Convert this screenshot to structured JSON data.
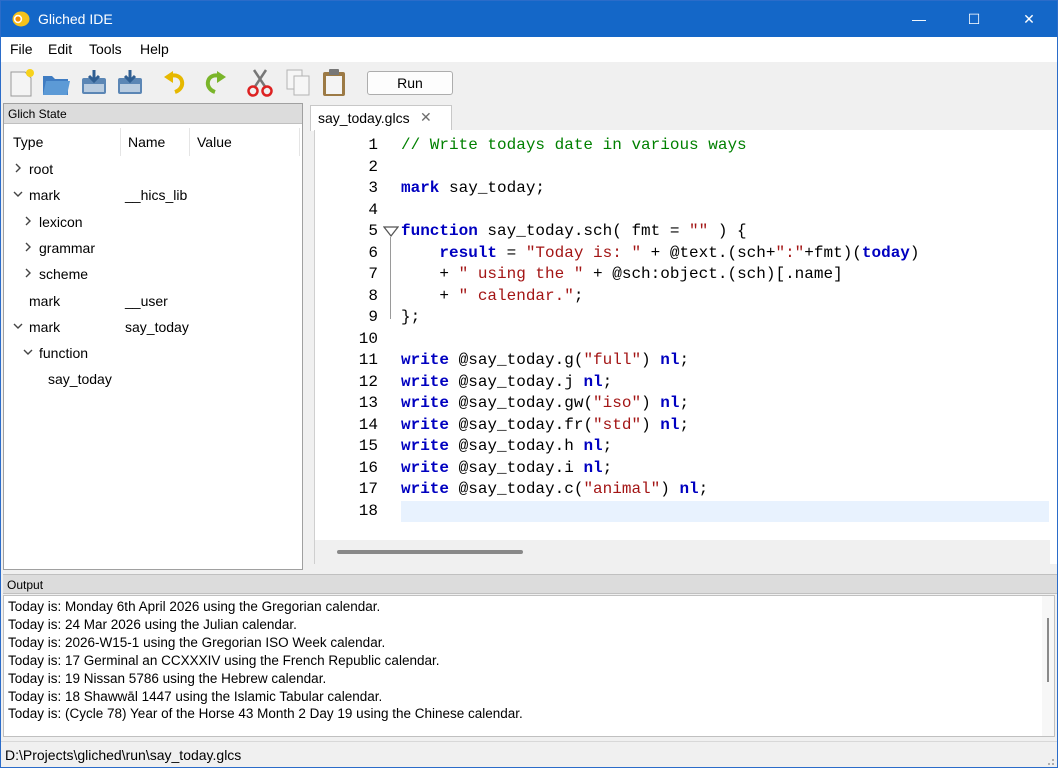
{
  "window": {
    "title": "Gliched IDE",
    "minimize_glyph": "—",
    "maximize_glyph": "☐",
    "close_glyph": "✕",
    "titlebar_color": "#1467c8"
  },
  "menu": [
    "File",
    "Edit",
    "Tools",
    "Help"
  ],
  "toolbar": {
    "icons": [
      "new-file-icon",
      "open-folder-icon",
      "save-icon",
      "save-as-icon",
      "undo-icon",
      "redo-icon",
      "cut-icon",
      "copy-icon",
      "paste-icon"
    ],
    "run_label": "Run"
  },
  "state_panel": {
    "title": "Glich State",
    "columns": [
      "Type",
      "Name",
      "Value"
    ],
    "rows": [
      {
        "chevron": "right",
        "type": "root",
        "name": ""
      },
      {
        "chevron": "down",
        "type": "mark",
        "name": "__hics_lib"
      },
      {
        "chevron": "right",
        "type": "lexicon",
        "name": ""
      },
      {
        "chevron": "right",
        "type": "grammar",
        "name": ""
      },
      {
        "chevron": "right",
        "type": "scheme",
        "name": ""
      },
      {
        "chevron": "none",
        "type": "mark",
        "name": "__user"
      },
      {
        "chevron": "down",
        "type": "mark",
        "name": "say_today"
      },
      {
        "chevron": "down",
        "type": "function",
        "name": ""
      },
      {
        "chevron": "none",
        "type": "say_today",
        "name": ""
      }
    ]
  },
  "editor": {
    "tab_label": "say_today.glcs",
    "tab_close": "✕",
    "lines": [
      [
        [
          "cm",
          "// Write todays date in various ways"
        ]
      ],
      [],
      [
        [
          "kw",
          "mark"
        ],
        [
          "pl",
          " say_today;"
        ]
      ],
      [],
      [
        [
          "kw",
          "function"
        ],
        [
          "pl",
          " say_today.sch( fmt = "
        ],
        [
          "st",
          "\"\""
        ],
        [
          "pl",
          " ) {"
        ]
      ],
      [
        [
          "pl",
          "    "
        ],
        [
          "kw",
          "result"
        ],
        [
          "pl",
          " = "
        ],
        [
          "st",
          "\"Today is: \""
        ],
        [
          "pl",
          " + @text.(sch+"
        ],
        [
          "st",
          "\":\""
        ],
        [
          "pl",
          "+fmt)("
        ],
        [
          "kw",
          "today"
        ],
        [
          "pl",
          ")"
        ]
      ],
      [
        [
          "pl",
          "    + "
        ],
        [
          "st",
          "\" using the \""
        ],
        [
          "pl",
          " + @sch:object.(sch)[.name]"
        ]
      ],
      [
        [
          "pl",
          "    + "
        ],
        [
          "st",
          "\" calendar.\""
        ],
        [
          "pl",
          ";"
        ]
      ],
      [
        [
          "pl",
          "};"
        ]
      ],
      [],
      [
        [
          "kw",
          "write"
        ],
        [
          "pl",
          " @say_today.g("
        ],
        [
          "st",
          "\"full\""
        ],
        [
          "pl",
          ") "
        ],
        [
          "kw",
          "nl"
        ],
        [
          "pl",
          ";"
        ]
      ],
      [
        [
          "kw",
          "write"
        ],
        [
          "pl",
          " @say_today.j "
        ],
        [
          "kw",
          "nl"
        ],
        [
          "pl",
          ";"
        ]
      ],
      [
        [
          "kw",
          "write"
        ],
        [
          "pl",
          " @say_today.gw("
        ],
        [
          "st",
          "\"iso\""
        ],
        [
          "pl",
          ") "
        ],
        [
          "kw",
          "nl"
        ],
        [
          "pl",
          ";"
        ]
      ],
      [
        [
          "kw",
          "write"
        ],
        [
          "pl",
          " @say_today.fr("
        ],
        [
          "st",
          "\"std\""
        ],
        [
          "pl",
          ") "
        ],
        [
          "kw",
          "nl"
        ],
        [
          "pl",
          ";"
        ]
      ],
      [
        [
          "kw",
          "write"
        ],
        [
          "pl",
          " @say_today.h "
        ],
        [
          "kw",
          "nl"
        ],
        [
          "pl",
          ";"
        ]
      ],
      [
        [
          "kw",
          "write"
        ],
        [
          "pl",
          " @say_today.i "
        ],
        [
          "kw",
          "nl"
        ],
        [
          "pl",
          ";"
        ]
      ],
      [
        [
          "kw",
          "write"
        ],
        [
          "pl",
          " @say_today.c("
        ],
        [
          "st",
          "\"animal\""
        ],
        [
          "pl",
          ") "
        ],
        [
          "kw",
          "nl"
        ],
        [
          "pl",
          ";"
        ]
      ],
      []
    ],
    "current_line": 18,
    "fold_line": 5
  },
  "output": {
    "title": "Output",
    "lines": [
      "Today is: Monday 6th April 2026 using the Gregorian calendar.",
      "Today is: 24 Mar 2026 using the Julian calendar.",
      "Today is: 2026-W15-1 using the Gregorian ISO Week calendar.",
      "Today is: 17 Germinal an CCXXXIV using the French Republic calendar.",
      "Today is: 19 Nissan 5786 using the Hebrew calendar.",
      "Today is: 18 Shawwāl 1447 using the Islamic Tabular calendar.",
      "Today is: (Cycle 78) Year of the Horse 43 Month 2 Day 19 using the Chinese calendar."
    ]
  },
  "status": {
    "path": "D:\\Projects\\gliched\\run\\say_today.glcs"
  }
}
